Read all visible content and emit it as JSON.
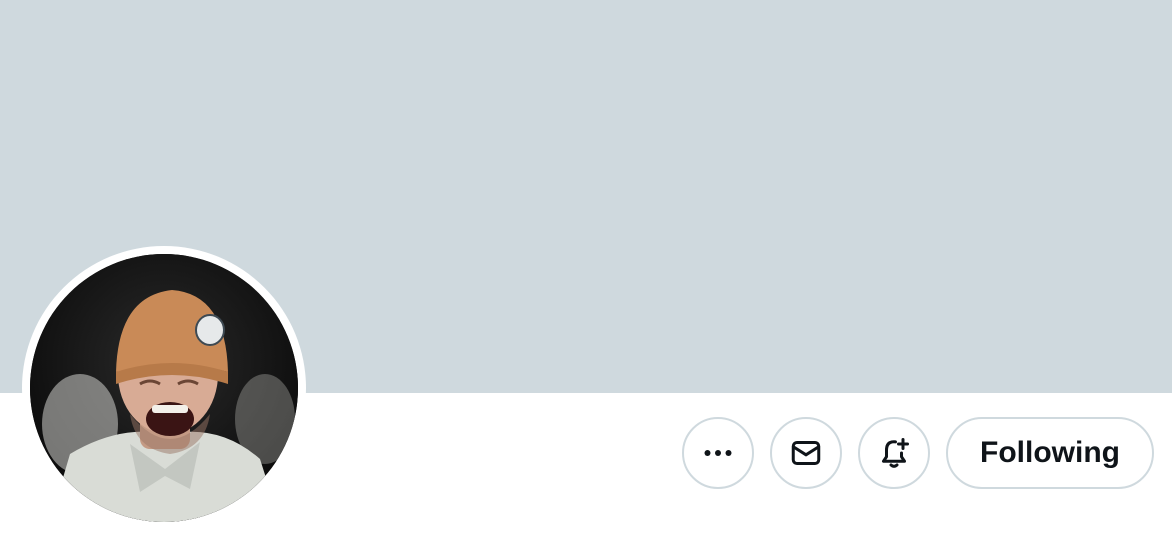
{
  "profile": {
    "banner_color": "#cfd9de",
    "avatar_alt": "avatar",
    "actions": {
      "more_icon": "more-horizontal-icon",
      "message_icon": "envelope-icon",
      "notify_icon": "bell-plus-icon",
      "follow_label": "Following"
    },
    "colors": {
      "border": "#cfd9de",
      "text": "#0f1419"
    }
  }
}
